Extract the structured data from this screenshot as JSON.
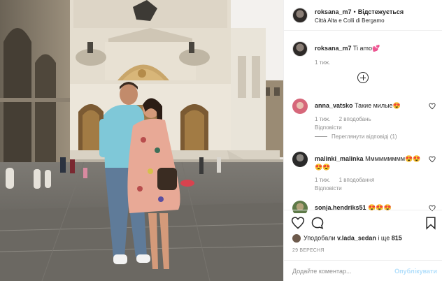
{
  "post_header": {
    "username": "roksana_m7",
    "separator": "•",
    "follow_label": "Відстежується",
    "location": "Città Alta e Colli di Bergamo"
  },
  "caption": {
    "username": "roksana_m7",
    "text": "Ti amo💕",
    "time": "1 тиж."
  },
  "comments": [
    {
      "username": "anna_vatsko",
      "text": "Такие милые😍",
      "time": "1 тиж.",
      "likes": "2 вподобань",
      "reply": "Відповісти",
      "view_replies": "Переглянути відповіді (1)"
    },
    {
      "username": "malinki_malinka",
      "text": "Ммммммммм😍😍",
      "text2": "😍😍",
      "time": "1 тиж.",
      "likes": "1 вподобання",
      "reply": "Відповісти"
    },
    {
      "username": "sonja.hendriks51",
      "text": "😍😍😍"
    }
  ],
  "likes_line": {
    "prefix": "Уподобали",
    "user": "v.lada_sedan",
    "suffix": "і ще",
    "count": "815"
  },
  "date": "29 ВЕРЕСНЯ",
  "add_comment": {
    "placeholder": "Додайте коментар...",
    "publish": "Опублікувати"
  },
  "icons": {
    "like": "heart-icon",
    "comment": "comment-icon",
    "save": "bookmark-icon",
    "add": "plus-circle-icon"
  },
  "colors": {
    "accent_link": "#b2dffc",
    "muted": "#8e8e8e",
    "text": "#262626",
    "border": "#efefef"
  }
}
